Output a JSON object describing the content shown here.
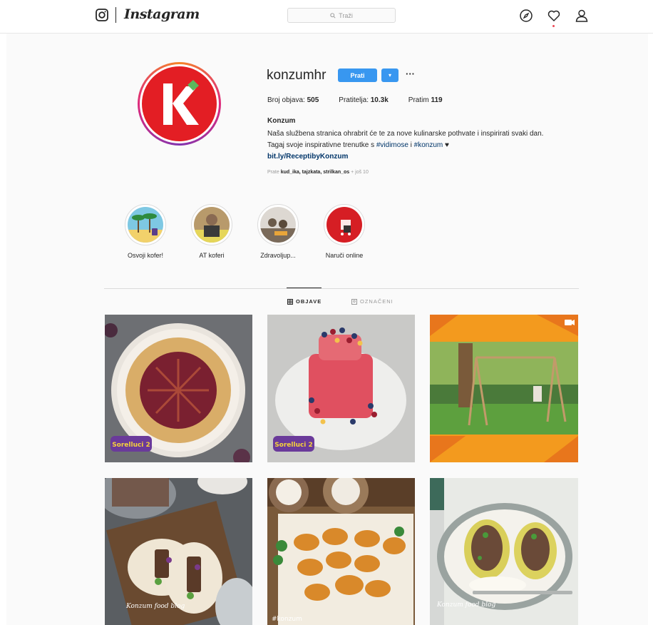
{
  "app": {
    "brand": "Instagram",
    "search_placeholder": "Traži",
    "icons": [
      "instagram-camera-icon",
      "search-icon",
      "compass-icon",
      "heart-icon",
      "user-icon"
    ]
  },
  "profile": {
    "username": "konzumhr",
    "follow_label": "Prati",
    "more_label": "···",
    "stats": {
      "posts_label": "Broj objava:",
      "posts_value": "505",
      "followers_label": "Pratitelja:",
      "followers_value": "10.3k",
      "following_label": "Pratim",
      "following_value": "119"
    },
    "bio_name": "Konzum",
    "bio_line1": "Naša službena stranica ohrabrit će te za nove kulinarske pothvate i inspirirati svaki dan.",
    "bio_line2_prefix": "Tagaj svoje inspirativne trenutke s ",
    "hashtag1": "#vidimose",
    "bio_line2_mid": " i ",
    "hashtag2": "#konzum",
    "heart": " ♥",
    "link": "bit.ly/ReceptibyKonzum",
    "followed_by_prefix": "Prate ",
    "followed_by_names": "kud_ika, tajzkata, strilkan_os",
    "followed_by_more": " + još 10"
  },
  "highlights": [
    {
      "label": "Osvoji kofer!"
    },
    {
      "label": "AT koferi"
    },
    {
      "label": "Zdravoljup..."
    },
    {
      "label": "Naruči online"
    }
  ],
  "tabs": [
    {
      "label": "OBJAVE",
      "active": true
    },
    {
      "label": "OZNAČENI",
      "active": false
    }
  ],
  "posts": [
    {
      "badge": "Sorelluci 2",
      "type": "image"
    },
    {
      "badge": "Sorelluci 2",
      "type": "image"
    },
    {
      "type": "video"
    },
    {
      "watermark": "Konzum food blog",
      "type": "image"
    },
    {
      "watermark": "#konzum",
      "type": "image"
    },
    {
      "watermark": "Konzum food blog",
      "type": "image"
    }
  ],
  "colors": {
    "accent": "#3897f0",
    "brand_red": "#e31e24",
    "brand_green": "#4caf50",
    "link": "#003569"
  }
}
